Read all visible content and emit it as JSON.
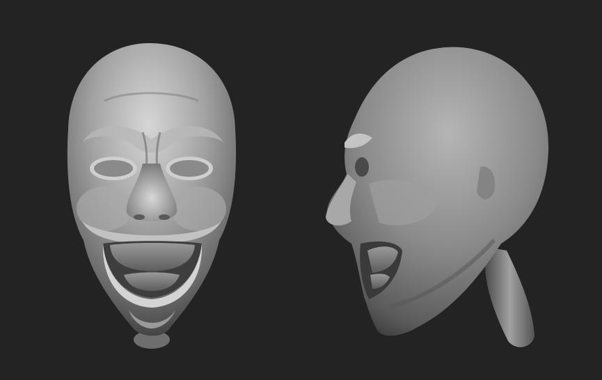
{
  "scene": {
    "background_color": "#232323",
    "material_color": "#8c8c8c",
    "highlight_color": "#d9d9d9",
    "shadow_color": "#1a1a1a",
    "objects": [
      {
        "icon": "sculpted-head-front-view"
      },
      {
        "icon": "sculpted-head-side-view"
      }
    ]
  }
}
